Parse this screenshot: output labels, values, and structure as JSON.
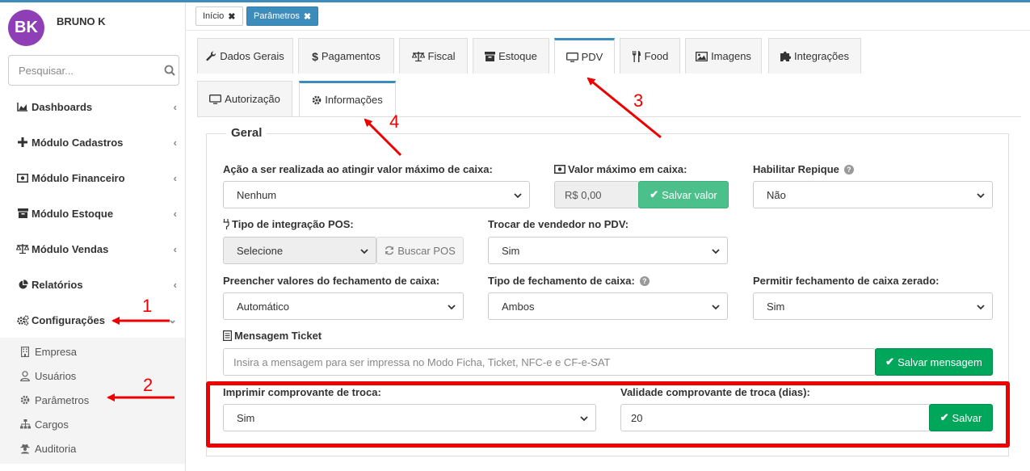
{
  "user": {
    "initials": "BK",
    "name": "BRUNO K"
  },
  "search": {
    "placeholder": "Pesquisar..."
  },
  "nav": {
    "items": [
      {
        "label": "Dashboards",
        "icon": "chart-area-icon"
      },
      {
        "label": "Módulo Cadastros",
        "icon": "plus-icon"
      },
      {
        "label": "Módulo Financeiro",
        "icon": "money-icon"
      },
      {
        "label": "Módulo Estoque",
        "icon": "archive-icon"
      },
      {
        "label": "Módulo Vendas",
        "icon": "balance-scale-icon"
      },
      {
        "label": "Relatórios",
        "icon": "pie-chart-icon"
      },
      {
        "label": "Configurações",
        "icon": "gears-icon"
      }
    ],
    "sub_items": [
      {
        "label": "Empresa",
        "icon": "building-icon"
      },
      {
        "label": "Usuários",
        "icon": "user-icon"
      },
      {
        "label": "Parâmetros",
        "icon": "gear-icon"
      },
      {
        "label": "Cargos",
        "icon": "sitemap-icon"
      },
      {
        "label": "Auditoria",
        "icon": "user-secret-icon"
      }
    ]
  },
  "tags": [
    {
      "label": "Início"
    },
    {
      "label": "Parâmetros"
    }
  ],
  "tabs_main": [
    {
      "label": "Dados Gerais",
      "icon": "wrench-icon"
    },
    {
      "label": "Pagamentos",
      "icon": "dollar-icon"
    },
    {
      "label": "Fiscal",
      "icon": "balance-scale-icon"
    },
    {
      "label": "Estoque",
      "icon": "archive-icon"
    },
    {
      "label": "PDV",
      "icon": "desktop-icon"
    },
    {
      "label": "Food",
      "icon": "cutlery-icon"
    },
    {
      "label": "Imagens",
      "icon": "image-icon"
    },
    {
      "label": "Integrações",
      "icon": "puzzle-icon"
    }
  ],
  "tabs_sub": [
    {
      "label": "Autorização",
      "icon": "desktop-icon"
    },
    {
      "label": "Informações",
      "icon": "gear-icon"
    }
  ],
  "section": {
    "legend": "Geral"
  },
  "form": {
    "acao_label": "Ação a ser realizada ao atingir valor máximo de caixa:",
    "acao_value": "Nenhum",
    "valor_max_label": "Valor máximo em caixa:",
    "valor_max_value": "R$ 0,00",
    "salvar_valor": "Salvar valor",
    "repique_label": "Habilitar Repique",
    "repique_value": "Não",
    "pos_label": "Tipo de integração POS:",
    "pos_value": "Selecione",
    "buscar_pos": "Buscar POS",
    "trocar_vendedor_label": "Trocar de vendedor no PDV:",
    "trocar_vendedor_value": "Sim",
    "preencher_label": "Preencher valores do fechamento de caixa:",
    "preencher_value": "Automático",
    "tipo_fechamento_label": "Tipo de fechamento de caixa:",
    "tipo_fechamento_value": "Ambos",
    "permitir_zerado_label": "Permitir fechamento de caixa zerado:",
    "permitir_zerado_value": "Sim",
    "mensagem_label": "Mensagem Ticket",
    "mensagem_placeholder": "Insira a mensagem para ser impressa no Modo Ficha, Ticket, NFC-e e CF-e-SAT",
    "salvar_mensagem": "Salvar mensagem",
    "imprimir_troca_label": "Imprimir comprovante de troca:",
    "imprimir_troca_value": "Sim",
    "validade_label": "Validade comprovante de troca (dias):",
    "validade_value": "20",
    "salvar": "Salvar"
  },
  "annotations": [
    "1",
    "2",
    "3",
    "4"
  ],
  "colors": {
    "accent": "#3c8dbc",
    "green": "#00a65a",
    "highlight": "#e00000",
    "avatar": "#8e3fb6"
  }
}
